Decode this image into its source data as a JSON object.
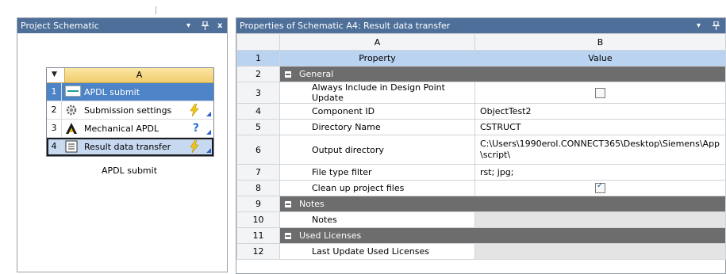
{
  "colors": {
    "titlebar": "#4d6f99",
    "selected_row": "#4c84c7",
    "header_row": "#b9d3f0",
    "group_row": "#6d6d6d",
    "status_lightning": "#f2c811",
    "status_question": "#2a6fd6"
  },
  "left_pane": {
    "title": "Project Schematic",
    "controls": {
      "dropdown": "▾",
      "pin": "ᵖ",
      "close": "x"
    },
    "system": {
      "column": "A",
      "caption": "APDL submit",
      "rows": [
        {
          "num": "1",
          "label": "APDL submit",
          "icon": "siemens-logo-icon",
          "status": ""
        },
        {
          "num": "2",
          "label": "Submission settings",
          "icon": "gear-icon",
          "status": "lightning-icon"
        },
        {
          "num": "3",
          "label": "Mechanical APDL",
          "icon": "ansys-logo-icon",
          "status": "question-icon"
        },
        {
          "num": "4",
          "label": "Result data transfer",
          "icon": "list-icon",
          "status": "lightning-icon"
        }
      ]
    }
  },
  "right_pane": {
    "title": "Properties of Schematic A4: Result data transfer",
    "controls": {
      "dropdown": "▾",
      "pin": "ᵖ"
    },
    "columns": [
      "A",
      "B"
    ],
    "header": {
      "num": "1",
      "property": "Property",
      "value": "Value"
    },
    "rows": [
      {
        "num": "2",
        "type": "group",
        "label": "General"
      },
      {
        "num": "3",
        "type": "prop",
        "label": "Always Include in Design Point Update",
        "value": "",
        "checkbox": false
      },
      {
        "num": "4",
        "type": "prop",
        "label": "Component ID",
        "value": "ObjectTest2"
      },
      {
        "num": "5",
        "type": "prop",
        "label": "Directory Name",
        "value": "CSTRUCT"
      },
      {
        "num": "6",
        "type": "prop",
        "label": "Output directory",
        "value": "C:\\Users\\1990erol.CONNECT365\\Desktop\\Siemens\\App \\script\\"
      },
      {
        "num": "7",
        "type": "prop",
        "label": "File type filter",
        "value": "rst; jpg;"
      },
      {
        "num": "8",
        "type": "prop",
        "label": "Clean up project files",
        "value": "",
        "checkbox": true
      },
      {
        "num": "9",
        "type": "group",
        "label": "Notes"
      },
      {
        "num": "10",
        "type": "prop",
        "label": "Notes",
        "value": ""
      },
      {
        "num": "11",
        "type": "group",
        "label": "Used Licenses"
      },
      {
        "num": "12",
        "type": "prop",
        "label": "Last Update Used Licenses",
        "value": ""
      }
    ]
  }
}
